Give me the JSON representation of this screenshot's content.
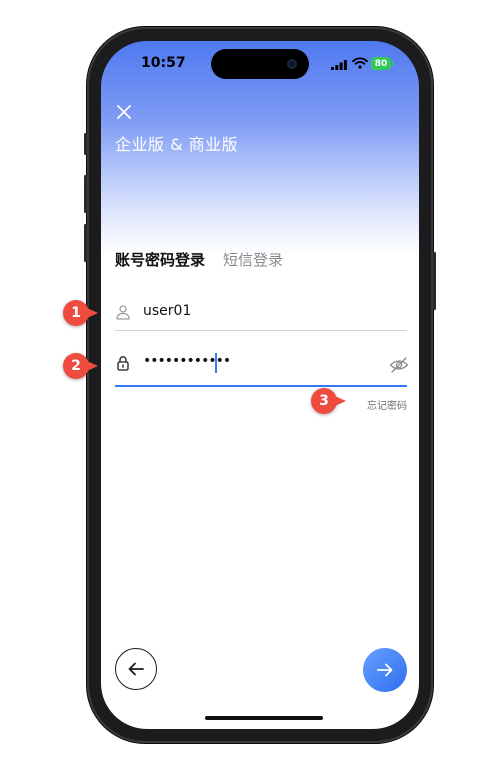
{
  "status_bar": {
    "time": "10:57",
    "battery": "80"
  },
  "header": {
    "title": "企业版 & 商业版"
  },
  "tabs": [
    {
      "label": "账号密码登录",
      "active": true
    },
    {
      "label": "短信登录",
      "active": false
    }
  ],
  "form": {
    "username": {
      "value": "user01"
    },
    "password": {
      "masked_value": "••••••••••••"
    },
    "forgot_password_label": "忘记密码"
  },
  "markers": [
    "1",
    "2",
    "3"
  ],
  "colors": {
    "accent": "#3478f6",
    "marker": "#ef4b3f",
    "header_gradient_top": "#4f79f0"
  },
  "icons": {
    "close": "close-icon",
    "user": "user-icon",
    "lock": "lock-icon",
    "eye": "eye-off-icon",
    "back": "arrow-left-icon",
    "next": "arrow-right-icon"
  }
}
